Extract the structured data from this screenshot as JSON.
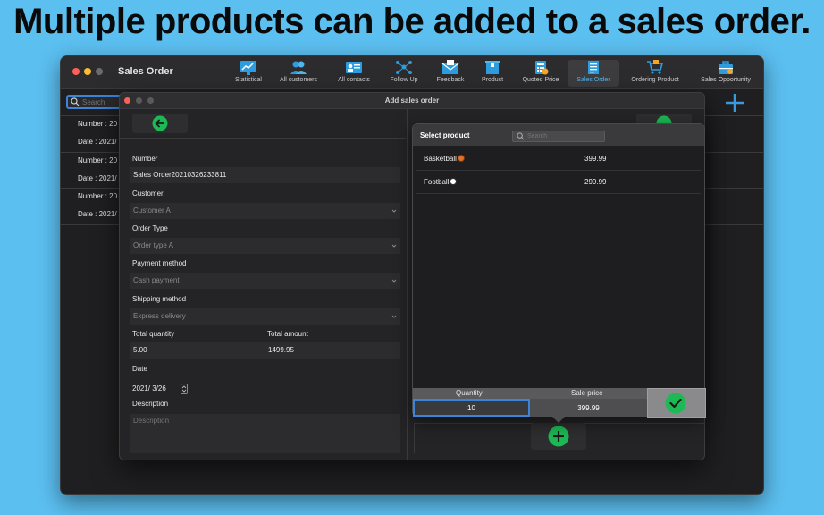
{
  "headline": "Multiple products can be added to a sales order.",
  "main_window": {
    "title": "Sales Order",
    "toolbar": [
      {
        "label": "Statistical",
        "icon": "chart-icon"
      },
      {
        "label": "All customers",
        "icon": "customers-icon"
      },
      {
        "label": "All contacts",
        "icon": "contacts-icon"
      },
      {
        "label": "Follow Up",
        "icon": "follow-up-icon"
      },
      {
        "label": "Feedback",
        "icon": "feedback-icon"
      },
      {
        "label": "Product",
        "icon": "product-icon"
      },
      {
        "label": "Quoted Price",
        "icon": "calculator-icon"
      },
      {
        "label": "Sales Order",
        "icon": "sales-order-icon",
        "active": true
      },
      {
        "label": "Ordering Product",
        "icon": "cart-icon"
      },
      {
        "label": "Sales Opportunity",
        "icon": "briefcase-icon"
      }
    ],
    "search_placeholder": "Search",
    "orders": [
      {
        "number": "Number : 20",
        "date": "Date : 2021/"
      },
      {
        "number": "Number : 20",
        "date": "Date : 2021/"
      },
      {
        "number": "Number : 20",
        "date": "Date : 2021/"
      }
    ]
  },
  "add_window": {
    "title": "Add sales order",
    "form": {
      "number_label": "Number",
      "number_value": "Sales Order20210326233811",
      "customer_label": "Customer",
      "customer_value": "Customer A",
      "order_type_label": "Order Type",
      "order_type_value": "Order type A",
      "payment_label": "Payment method",
      "payment_value": "Cash payment",
      "shipping_label": "Shipping method",
      "shipping_value": "Express delivery",
      "total_qty_label": "Total quantity",
      "total_qty_value": "5.00",
      "total_amount_label": "Total amount",
      "total_amount_value": "1499.95",
      "date_label": "Date",
      "date_value": "2021/  3/26",
      "description_label": "Description",
      "description_placeholder": "Description"
    }
  },
  "popover": {
    "title": "Select product",
    "search_placeholder": "Search",
    "products": [
      {
        "name": "Basketball",
        "price": "399.99",
        "emoji_color": "#e0702a"
      },
      {
        "name": "Football",
        "price": "299.99",
        "emoji_color": "#ffffff"
      }
    ],
    "quantity_label": "Quantity",
    "quantity_value": "10",
    "sale_price_label": "Sale price",
    "sale_price_value": "399.99"
  },
  "colors": {
    "accent_green": "#1db954",
    "accent_blue": "#4fb7f0",
    "background": "#5bbff0"
  }
}
